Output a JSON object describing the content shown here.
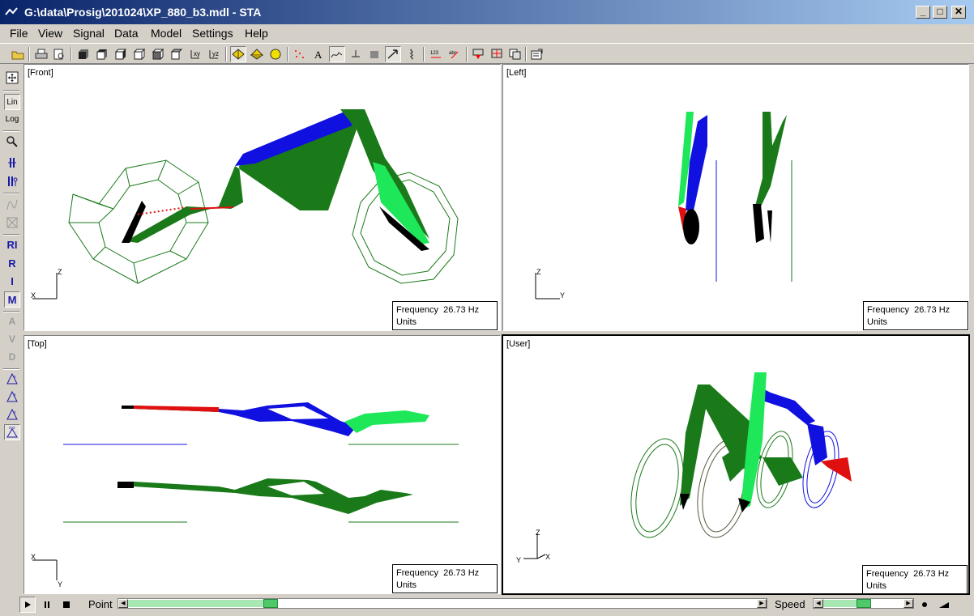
{
  "window": {
    "title": "G:\\data\\Prosig\\201024\\XP_880_b3.mdl - STA",
    "controls": {
      "minimize": "_",
      "maximize": "□",
      "close": "✕"
    }
  },
  "menu": [
    "File",
    "View",
    "Signal",
    "Data",
    "Model",
    "Settings",
    "Help"
  ],
  "toolbar": {
    "buttons": [
      "open-icon",
      "print-icon",
      "print-preview-icon",
      "cube-view-1-icon",
      "cube-view-2-icon",
      "cube-view-3-icon",
      "cube-view-4-icon",
      "cube-view-5-icon",
      "axis-view-1-icon",
      "axis-view-2-icon",
      "yellow-shape-1-icon",
      "yellow-shape-2-icon",
      "yellow-circle-icon",
      "points-icon",
      "text-annotation-icon",
      "deform-icon",
      "force-icon",
      "fill-icon",
      "arrow-icon",
      "spring-icon",
      "numbering-icon",
      "labels-icon",
      "marker-down-icon",
      "marker-split-icon",
      "copy-view-icon",
      "properties-icon"
    ]
  },
  "sidebar": {
    "lin_label": "Lin",
    "log_label": "Log",
    "ri_label": "RI",
    "r_label": "R",
    "i_label": "I",
    "m_label": "M",
    "a_label": "A",
    "v_label": "V",
    "d_label": "D"
  },
  "views": [
    {
      "label": "[Front]",
      "freq_label": "Frequency",
      "freq_value": "26.73 Hz",
      "units_label": "Units",
      "axis_a": "X",
      "axis_b": "Z"
    },
    {
      "label": "[Left]",
      "freq_label": "Frequency",
      "freq_value": "26.73 Hz",
      "units_label": "Units",
      "axis_a": "Y",
      "axis_b": "Z"
    },
    {
      "label": "[Top]",
      "freq_label": "Frequency",
      "freq_value": "26.73 Hz",
      "units_label": "Units",
      "axis_a": "X",
      "axis_b": "Y"
    },
    {
      "label": "[User]",
      "freq_label": "Frequency",
      "freq_value": "26.73 Hz",
      "units_label": "Units",
      "axis_a": "Z",
      "axis_b": "Y",
      "axis_c": "X"
    }
  ],
  "status": {
    "point_label": "Point",
    "speed_label": "Speed",
    "point_position": 0.22,
    "speed_position": 0.5
  },
  "colors": {
    "dark_green": "#1a7a1a",
    "light_green": "#1ee85a",
    "blue": "#1010e0",
    "red": "#e01010",
    "black": "#000000"
  }
}
